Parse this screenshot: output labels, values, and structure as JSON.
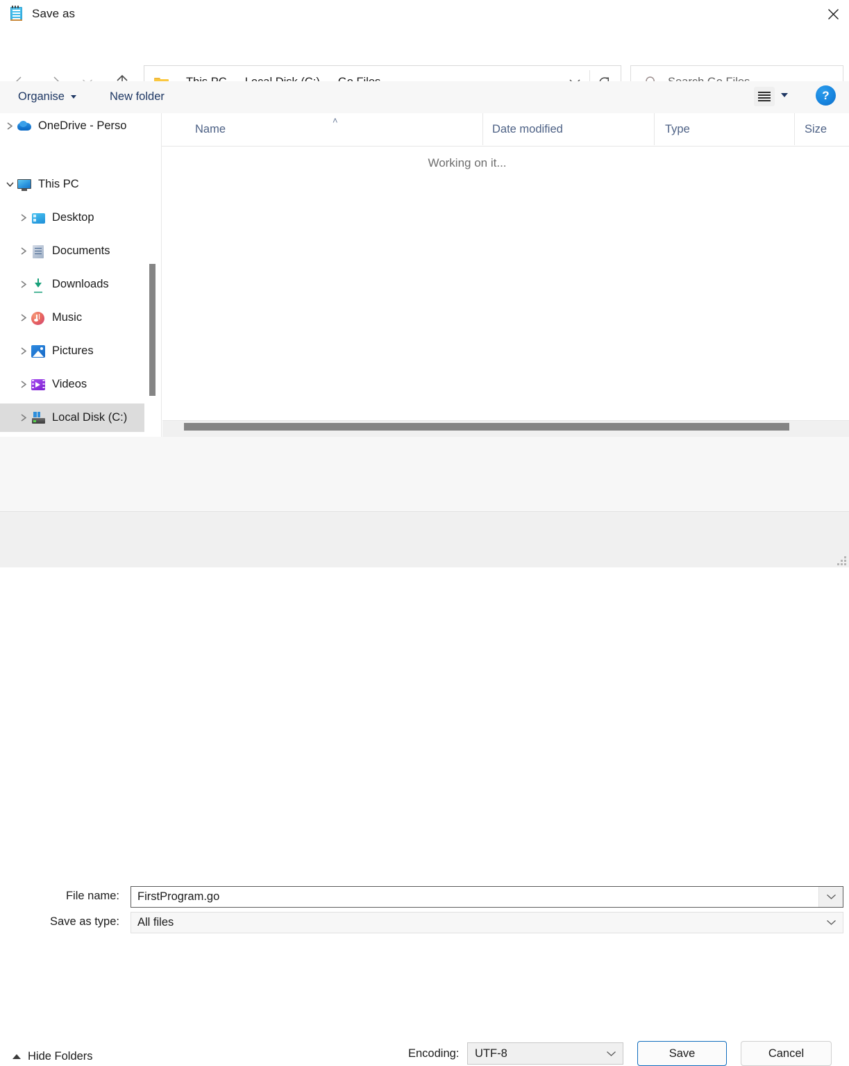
{
  "window": {
    "title": "Save as",
    "icon": "notepad-icon",
    "close_label": "✕"
  },
  "nav": {
    "back": "back-arrow",
    "forward": "forward-arrow",
    "recent": "recent-locations-chevron",
    "up": "up-arrow",
    "breadcrumb": [
      "This PC",
      "Local Disk (C:)",
      "Go Files"
    ],
    "separator": "›",
    "refresh": "refresh-icon",
    "dropdown": "chevron-down-icon"
  },
  "search": {
    "placeholder": "Search Go Files",
    "icon": "search-icon"
  },
  "toolbar": {
    "organise_label": "Organise",
    "new_folder_label": "New folder",
    "view_icon": "list-view-icon",
    "help_label": "?"
  },
  "sidebar": {
    "items": [
      {
        "label": "OneDrive - Perso",
        "icon": "onedrive-icon",
        "expanded": false,
        "indent": 0,
        "selected": false
      },
      {
        "label": "This PC",
        "icon": "this-pc-icon",
        "expanded": true,
        "indent": 0,
        "selected": false
      },
      {
        "label": "Desktop",
        "icon": "desktop-icon",
        "expanded": false,
        "indent": 1,
        "selected": false
      },
      {
        "label": "Documents",
        "icon": "documents-icon",
        "expanded": false,
        "indent": 1,
        "selected": false
      },
      {
        "label": "Downloads",
        "icon": "downloads-icon",
        "expanded": false,
        "indent": 1,
        "selected": false
      },
      {
        "label": "Music",
        "icon": "music-icon",
        "expanded": false,
        "indent": 1,
        "selected": false
      },
      {
        "label": "Pictures",
        "icon": "pictures-icon",
        "expanded": false,
        "indent": 1,
        "selected": false
      },
      {
        "label": "Videos",
        "icon": "videos-icon",
        "expanded": false,
        "indent": 1,
        "selected": false
      },
      {
        "label": "Local Disk (C:)",
        "icon": "local-disk-icon",
        "expanded": false,
        "indent": 1,
        "selected": true
      }
    ]
  },
  "filelist": {
    "columns": [
      "Name",
      "Date modified",
      "Type",
      "Size"
    ],
    "sort_column": "Name",
    "sort_caret": "˄",
    "rows": [],
    "empty_message": "Working on it..."
  },
  "form": {
    "filename_label": "File name:",
    "filename_value": "FirstProgram.go",
    "filetype_label": "Save as type:",
    "filetype_value": "All files"
  },
  "footer": {
    "hide_folders_label": "Hide Folders",
    "encoding_label": "Encoding:",
    "encoding_value": "UTF-8",
    "save_label": "Save",
    "cancel_label": "Cancel"
  },
  "colors": {
    "accent": "#0f6cbd",
    "help_blue": "#1886e0",
    "column_header_text": "#4d6185",
    "command_text": "#1f3864",
    "selection": "#dcdcdc"
  }
}
